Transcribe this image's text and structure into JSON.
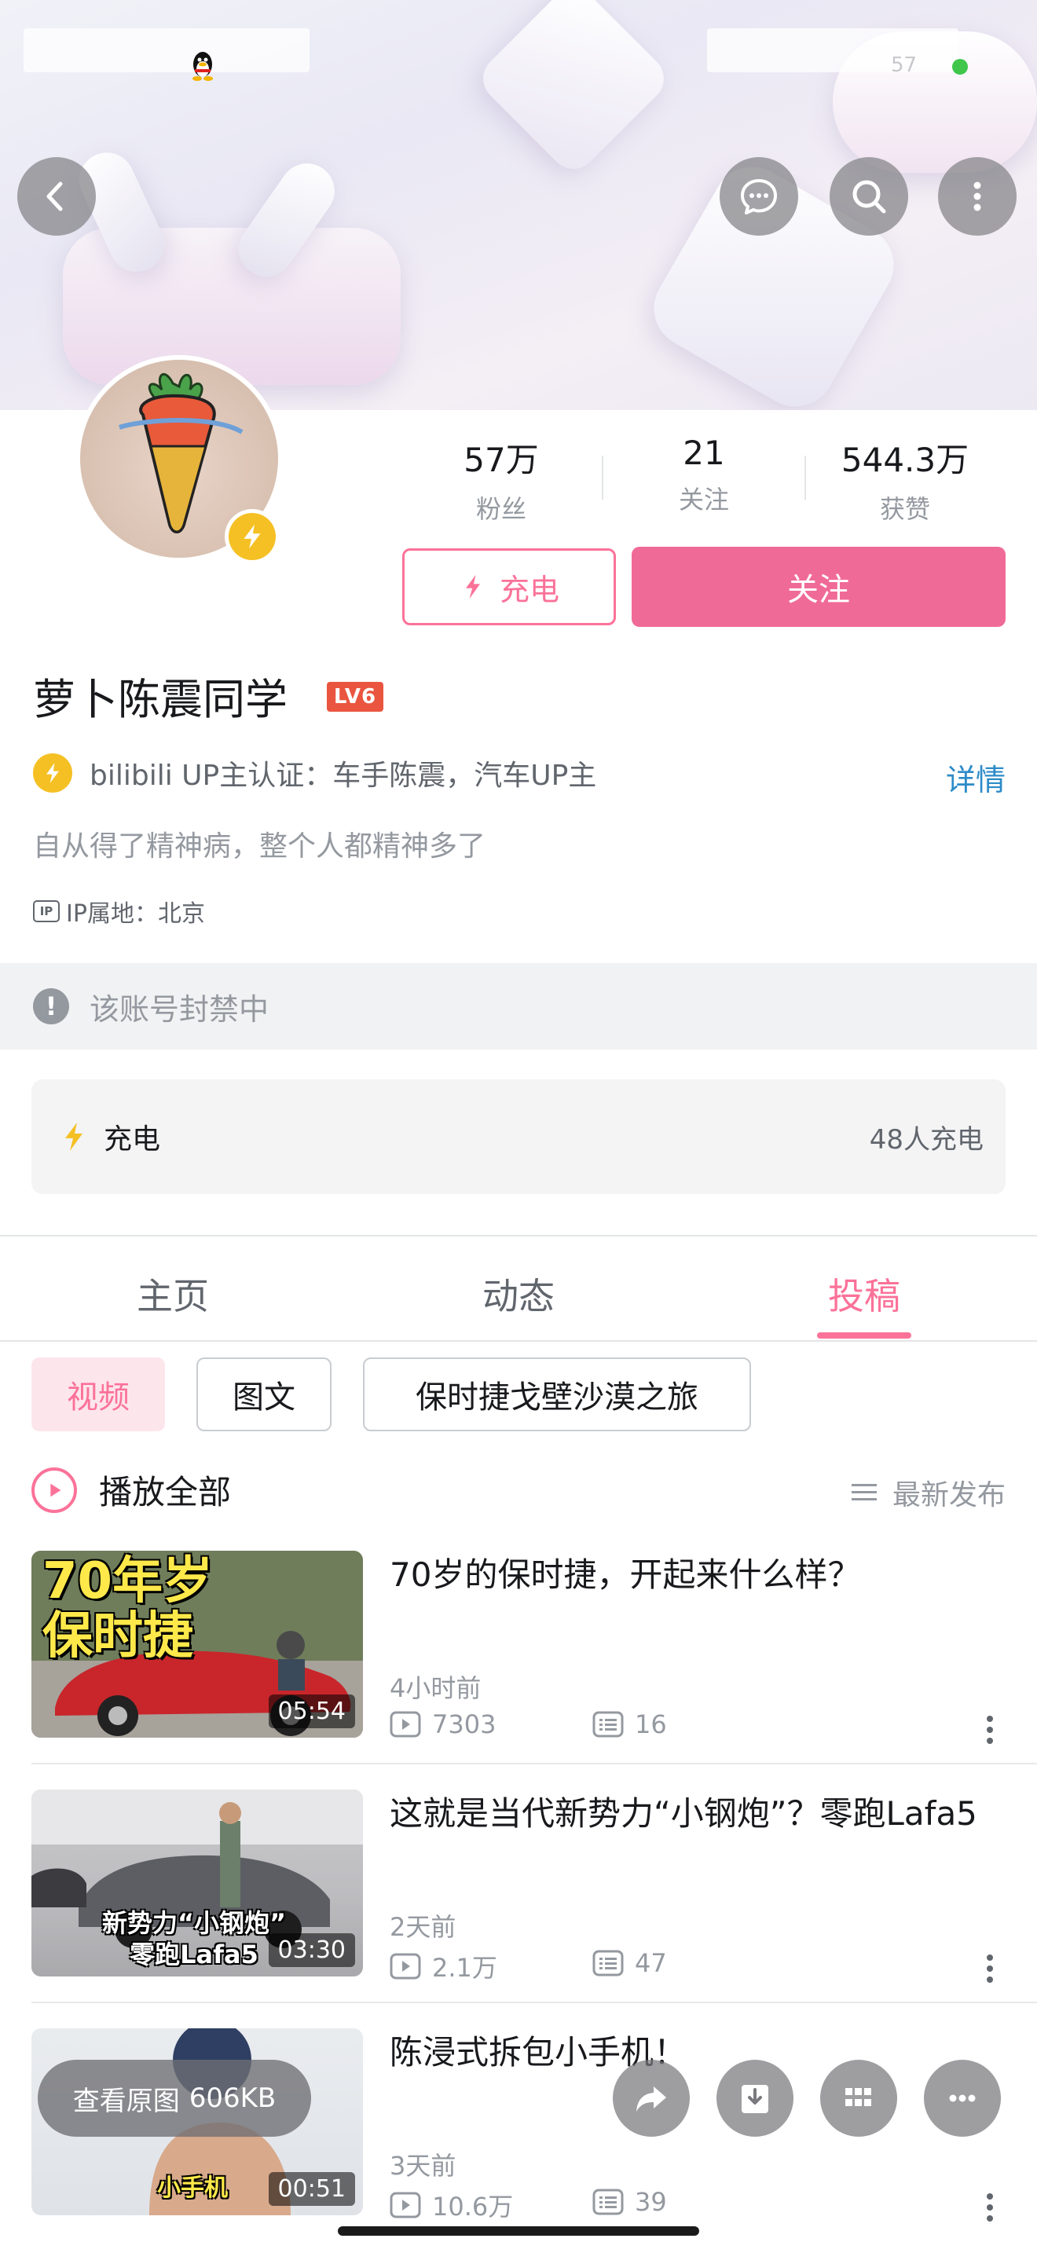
{
  "status": {
    "battery": "57"
  },
  "stats": [
    {
      "value": "57万",
      "label": "粉丝"
    },
    {
      "value": "21",
      "label": "关注"
    },
    {
      "value": "544.3万",
      "label": "获赞"
    }
  ],
  "actions": {
    "charge": "充电",
    "follow": "关注"
  },
  "profile": {
    "name": "萝卜陈震同学",
    "level": "LV6",
    "certification": "bilibili UP主认证：车手陈震，汽车UP主",
    "detail_link": "详情",
    "signature": "自从得了精神病，整个人都精神多了",
    "ip_icon": "IP",
    "ip": "IP属地：北京"
  },
  "ban_notice": "该账号封禁中",
  "charge_card": {
    "label": "充电",
    "count": "48人充电"
  },
  "tabs": [
    "主页",
    "动态",
    "投稿"
  ],
  "active_tab": "投稿",
  "filters": [
    "视频",
    "图文",
    "保时捷戈壁沙漠之旅"
  ],
  "play_all": "播放全部",
  "sort": "最新发布",
  "videos": [
    {
      "title": "70岁的保时捷，开起来什么样？",
      "time": "4小时前",
      "views": "7303",
      "danmaku": "16",
      "duration": "05:54",
      "caption": "70年岁\n保时捷"
    },
    {
      "title": "这就是当代新势力“小钢炮”？零跑Lafa5",
      "time": "2天前",
      "views": "2.1万",
      "danmaku": "47",
      "duration": "03:30",
      "caption": "新势力“小钢炮”\n零跑Lafa5"
    },
    {
      "title": "陈浸式拆包小手机！",
      "time": "3天前",
      "views": "10.6万",
      "danmaku": "39",
      "duration": "00:51",
      "caption": "小手机"
    }
  ],
  "overlay": {
    "view_original": "查看原图",
    "size": "606KB"
  },
  "colors": {
    "brand_pink": "#fb7299",
    "follow_pink": "#f06a98",
    "level_red": "#ea5540",
    "charge_yellow": "#f5c024",
    "link_blue": "#2d8bc8"
  }
}
